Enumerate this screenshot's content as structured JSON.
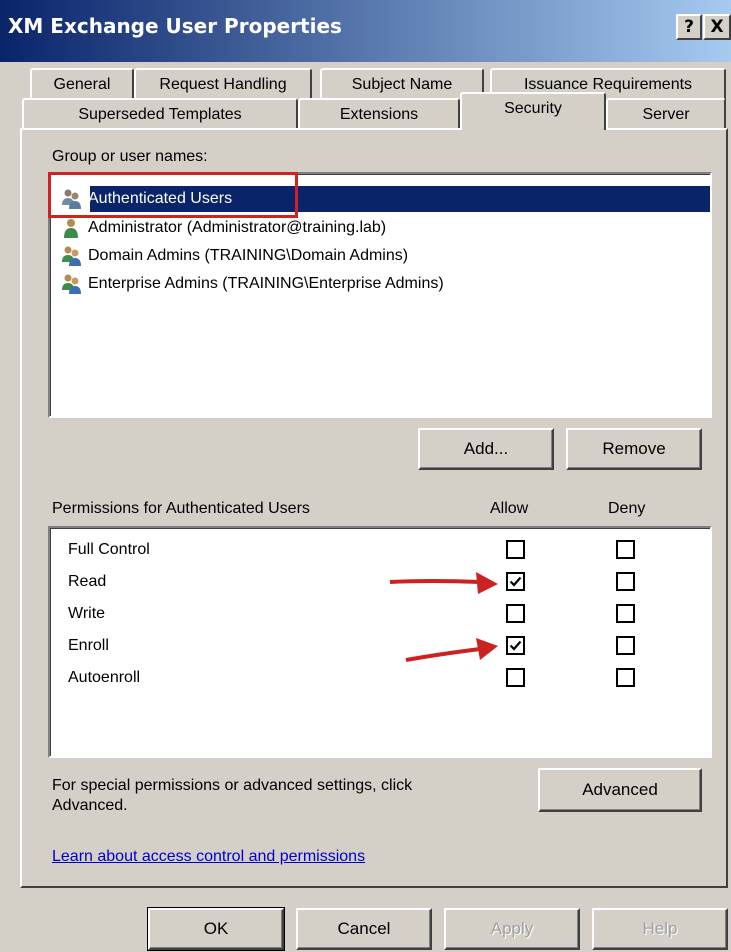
{
  "window": {
    "title": "XM Exchange User Properties",
    "help_btn": "?",
    "close_btn": "X"
  },
  "tabs_row1": [
    "General",
    "Request Handling",
    "Subject Name",
    "Issuance Requirements"
  ],
  "tabs_row2": [
    "Superseded Templates",
    "Extensions",
    "Security",
    "Server"
  ],
  "active_tab": "Security",
  "group_label": "Group or user names:",
  "users": [
    {
      "label": "Authenticated Users",
      "icon": "user-group-icon",
      "selected": true
    },
    {
      "label": "Administrator (Administrator@training.lab)",
      "icon": "user-icon",
      "selected": false
    },
    {
      "label": "Domain Admins (TRAINING\\Domain Admins)",
      "icon": "user-group-icon",
      "selected": false
    },
    {
      "label": "Enterprise Admins (TRAINING\\Enterprise Admins)",
      "icon": "user-group-icon",
      "selected": false
    }
  ],
  "buttons": {
    "add": "Add...",
    "remove": "Remove",
    "advanced": "Advanced",
    "ok": "OK",
    "cancel": "Cancel",
    "apply": "Apply",
    "help": "Help"
  },
  "permissions": {
    "header": "Permissions for Authenticated Users",
    "allow_header": "Allow",
    "deny_header": "Deny",
    "rows": [
      {
        "name": "Full Control",
        "allow": false,
        "deny": false
      },
      {
        "name": "Read",
        "allow": true,
        "deny": false
      },
      {
        "name": "Write",
        "allow": false,
        "deny": false
      },
      {
        "name": "Enroll",
        "allow": true,
        "deny": false
      },
      {
        "name": "Autoenroll",
        "allow": false,
        "deny": false
      }
    ]
  },
  "special_text": {
    "line1": "For special permissions or advanced settings, click",
    "line2": "Advanced."
  },
  "learn_link": "Learn about access control and permissions",
  "colors": {
    "selection": "#0a246a",
    "highlight_box": "#d32020",
    "arrow": "#cc2222"
  }
}
